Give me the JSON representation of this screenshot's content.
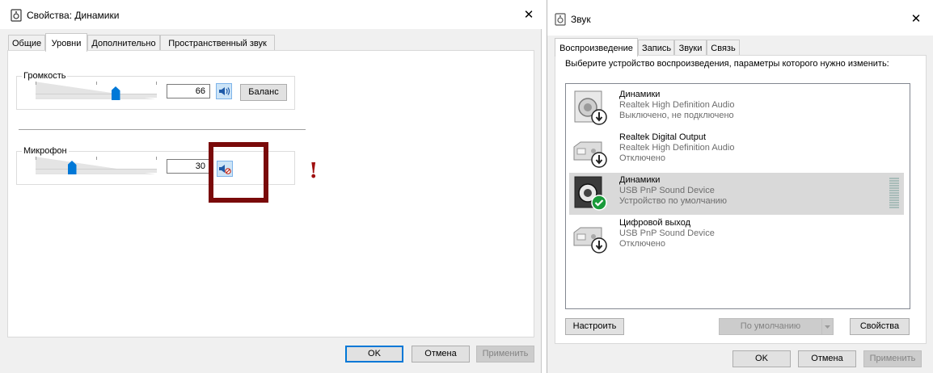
{
  "left_window": {
    "title": "Свойства: Динамики",
    "close_glyph": "✕",
    "tabs": [
      {
        "label": "Общие",
        "active": false
      },
      {
        "label": "Уровни",
        "active": true
      },
      {
        "label": "Дополнительно",
        "active": false
      },
      {
        "label": "Пространственный звук",
        "active": false
      }
    ],
    "volume": {
      "label": "Громкость",
      "value": "66",
      "level": 0.66,
      "muted": false,
      "speaker_icon": "speaker-icon",
      "balance_label": "Баланс"
    },
    "microphone": {
      "label": "Микрофон",
      "value": "30",
      "level": 0.3,
      "muted": true,
      "speaker_icon": "speaker-muted-icon"
    },
    "annotation_mark": "!",
    "annotation_color": "#7a0a0a",
    "buttons": {
      "ok": "OK",
      "cancel": "Отмена",
      "apply": "Применить"
    }
  },
  "right_window": {
    "title": "Звук",
    "close_glyph": "✕",
    "tabs": [
      {
        "label": "Воспроизведение",
        "active": true
      },
      {
        "label": "Запись",
        "active": false
      },
      {
        "label": "Звуки",
        "active": false
      },
      {
        "label": "Связь",
        "active": false
      }
    ],
    "hint": "Выберите устройство воспроизведения, параметры которого нужно изменить:",
    "devices": [
      {
        "name": "Динамики",
        "driver": "Realtek High Definition Audio",
        "status": "Выключено, не подключено",
        "icon": "speaker-device-icon",
        "badge": "down-arrow-badge",
        "selected": false
      },
      {
        "name": "Realtek Digital Output",
        "driver": "Realtek High Definition Audio",
        "status": "Отключено",
        "icon": "digital-output-icon",
        "badge": "down-arrow-badge",
        "selected": false
      },
      {
        "name": "Динамики",
        "driver": "USB PnP Sound Device",
        "status": "Устройство по умолчанию",
        "icon": "speaker-device-icon",
        "badge": "default-check-badge",
        "selected": true
      },
      {
        "name": "Цифровой выход",
        "driver": "USB PnP Sound Device",
        "status": "Отключено",
        "icon": "digital-output-icon",
        "badge": "down-arrow-badge",
        "selected": false
      }
    ],
    "buttons": {
      "configure": "Настроить",
      "set_default": "По умолчанию",
      "properties": "Свойства",
      "ok": "OK",
      "cancel": "Отмена",
      "apply": "Применить"
    },
    "colors": {
      "accent": "#0078d7",
      "check_green": "#1a9a3a"
    }
  }
}
